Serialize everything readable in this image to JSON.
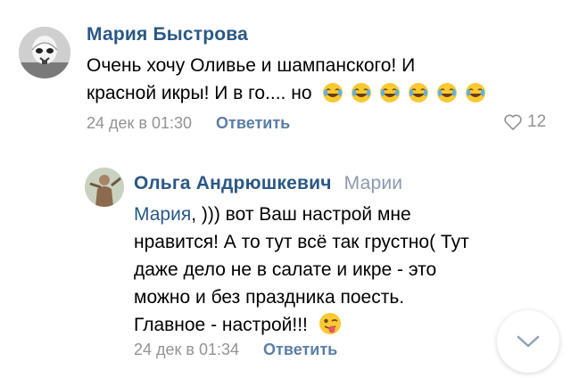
{
  "comments": [
    {
      "author": "Мария Быстрова",
      "text_line1": "Очень хочу Оливье и шампанского! И",
      "text_line2": "красной икры! И в го.... но",
      "date": "24 дек в 01:30",
      "reply_label": "Ответить",
      "likes": "12",
      "emoji": "joy",
      "emoji_count": 6
    },
    {
      "author": "Ольга Андрюшкевич",
      "reply_to_line1": "Марии",
      "reply_to_mention": "Мария",
      "text_first_rest": ", ))) вот Ваш настрой мне",
      "text_line2": "нравится! А то тут всё так грустно( Тут",
      "text_line3": "даже дело не в салате и икре - это",
      "text_line4": "можно и без праздника поесть.",
      "text_line5": "Главное - настрой!!!",
      "date": "24 дек в 01:34",
      "reply_label": "Ответить",
      "emoji": "winking-tongue"
    }
  ],
  "icons": {
    "like": "heart-icon",
    "scroll": "chevron-down-icon"
  },
  "colors": {
    "author": "#2a5885",
    "meta": "#939393",
    "reply_button": "#5b7fa6",
    "reply_to": "#8a9aab"
  }
}
